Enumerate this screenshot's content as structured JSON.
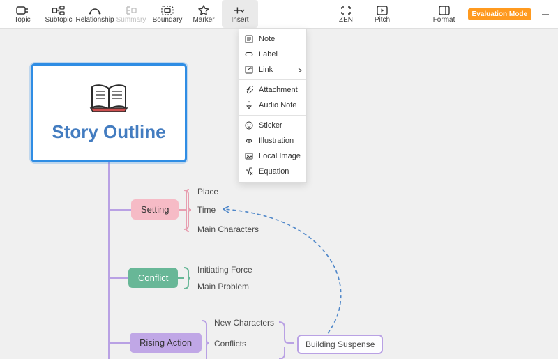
{
  "toolbar": {
    "left": [
      {
        "key": "topic",
        "label": "Topic",
        "icon": "topic-icon",
        "disabled": false
      },
      {
        "key": "subtopic",
        "label": "Subtopic",
        "icon": "subtopic-icon",
        "disabled": false
      },
      {
        "key": "relationship",
        "label": "Relationship",
        "icon": "relationship-icon",
        "disabled": false
      },
      {
        "key": "summary",
        "label": "Summary",
        "icon": "summary-icon",
        "disabled": true
      },
      {
        "key": "boundary",
        "label": "Boundary",
        "icon": "boundary-icon",
        "disabled": false
      },
      {
        "key": "marker",
        "label": "Marker",
        "icon": "marker-icon",
        "disabled": false
      },
      {
        "key": "insert",
        "label": "Insert",
        "icon": "insert-icon",
        "disabled": false,
        "active": true
      }
    ],
    "mid": [
      {
        "key": "zen",
        "label": "ZEN",
        "icon": "zen-icon"
      },
      {
        "key": "pitch",
        "label": "Pitch",
        "icon": "pitch-icon"
      }
    ],
    "right": [
      {
        "key": "format",
        "label": "Format",
        "icon": "format-icon"
      }
    ],
    "evaluation_label": "Evaluation Mode"
  },
  "insert_menu": {
    "groups": [
      [
        {
          "key": "note",
          "label": "Note",
          "icon": "note-icon"
        },
        {
          "key": "label",
          "label": "Label",
          "icon": "label-icon"
        },
        {
          "key": "link",
          "label": "Link",
          "icon": "link-icon",
          "submenu": true
        }
      ],
      [
        {
          "key": "attachment",
          "label": "Attachment",
          "icon": "attachment-icon"
        },
        {
          "key": "audio_note",
          "label": "Audio Note",
          "icon": "audio-note-icon"
        }
      ],
      [
        {
          "key": "sticker",
          "label": "Sticker",
          "icon": "sticker-icon"
        },
        {
          "key": "illustration",
          "label": "Illustration",
          "icon": "illustration-icon"
        },
        {
          "key": "local_image",
          "label": "Local Image",
          "icon": "local-image-icon"
        },
        {
          "key": "equation",
          "label": "Equation",
          "icon": "equation-icon"
        }
      ]
    ]
  },
  "mindmap": {
    "root_title": "Story Outline",
    "setting": {
      "label": "Setting",
      "leaves": [
        "Place",
        "Time",
        "Main Characters"
      ]
    },
    "conflict": {
      "label": "Conflict",
      "leaves": [
        "Initiating Force",
        "Main Problem"
      ]
    },
    "rising": {
      "label": "Rising Action",
      "leaves": [
        "New Characters",
        "Conflicts"
      ],
      "sub_box": "Building Suspense"
    }
  },
  "colors": {
    "accent": "#2f8de4",
    "root_text": "#437cc0",
    "setting": "#f6bbc6",
    "conflict": "#68b797",
    "rising": "#c0a7e6",
    "eval_badge": "#ff9a1f",
    "dashed_relation": "#4f87c9"
  }
}
